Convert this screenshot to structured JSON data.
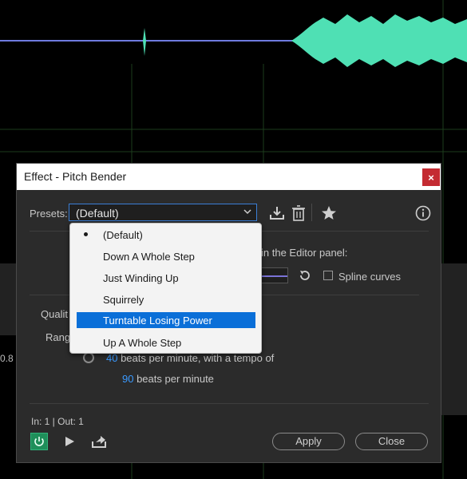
{
  "dialog": {
    "title": "Effect - Pitch Bender",
    "close_glyph": "×",
    "presets_label": "Presets:",
    "preset_value": "(Default)"
  },
  "dropdown": {
    "options": [
      {
        "label": "(Default)",
        "checked": true,
        "highlighted": false
      },
      {
        "label": "Down A Whole Step",
        "checked": false,
        "highlighted": false
      },
      {
        "label": "Just Winding Up",
        "checked": false,
        "highlighted": false
      },
      {
        "label": "Squirrely",
        "checked": false,
        "highlighted": false
      },
      {
        "label": "Turntable Losing Power",
        "checked": false,
        "highlighted": true
      },
      {
        "label": "Up A Whole Step",
        "checked": false,
        "highlighted": false
      }
    ]
  },
  "editor": {
    "panel_label_fragment": "in the Editor panel:",
    "spline_label": "Spline curves",
    "spline_checked": false
  },
  "options": {
    "quality_label_fragment": "Qualit",
    "range_label_fragment": "Range",
    "tempo_range_value": "40",
    "tempo_range_text": " beats per minute, with a tempo of",
    "tempo_value": "90",
    "tempo_text": " beats per minute"
  },
  "footer": {
    "io_text": "In: 1 | Out: 1",
    "apply_label": "Apply",
    "close_label": "Close"
  },
  "background": {
    "side_number": "0.8"
  },
  "colors": {
    "accent_blue": "#3a9aff",
    "selection_blue": "#0a6fd8",
    "waveform": "#4fe0b4",
    "close_red": "#c42b32",
    "power_green": "#1f8f5a"
  }
}
